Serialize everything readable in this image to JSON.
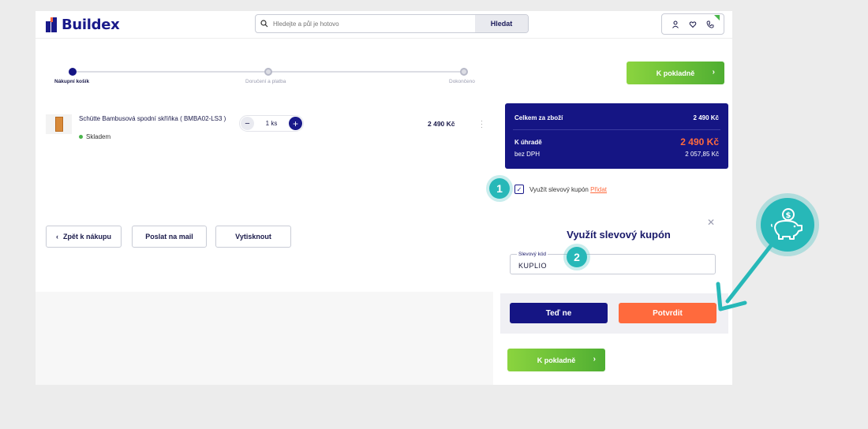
{
  "header": {
    "logo_text": "Buildex",
    "search_placeholder": "Hledejte a půl je hotovo",
    "search_button": "Hledat",
    "icons": [
      "user-icon",
      "heart-icon",
      "phone-icon"
    ]
  },
  "steps": [
    {
      "label": "Nákupní košík",
      "active": true
    },
    {
      "label": "Doručení a platba",
      "active": false
    },
    {
      "label": "Dokončeno",
      "active": false
    }
  ],
  "checkout_top_label": "K pokladně",
  "product": {
    "name": "Schütte Bambusová spodní skříňka ( BMBA02-LS3 )",
    "stock": "Skladem",
    "quantity": "1 ks",
    "price": "2 490 Kč"
  },
  "summary": {
    "total_goods_label": "Celkem za zboží",
    "total_goods_value": "2 490 Kč",
    "to_pay_label": "K úhradě",
    "to_pay_value": "2 490 Kč",
    "no_vat_label": "bez DPH",
    "no_vat_value": "2 057,85 Kč"
  },
  "coupon_toggle": {
    "label": "Využít slevový kupón",
    "link": "Přidat"
  },
  "buttons": {
    "back": "Zpět k nákupu",
    "mail": "Poslat na mail",
    "print": "Vytisknout"
  },
  "coupon_dialog": {
    "title": "Využít slevový kupón",
    "field_label": "Slevový kód",
    "field_value": "KUPLIO",
    "cancel": "Teď ne",
    "confirm": "Potvrdit"
  },
  "checkout_bottom_label": "K pokladně",
  "badges": [
    "1",
    "2"
  ],
  "colors": {
    "brand_navy": "#151584",
    "accent_orange": "#ff6a3d",
    "green": "#4fae32",
    "teal": "#27b8b8"
  }
}
